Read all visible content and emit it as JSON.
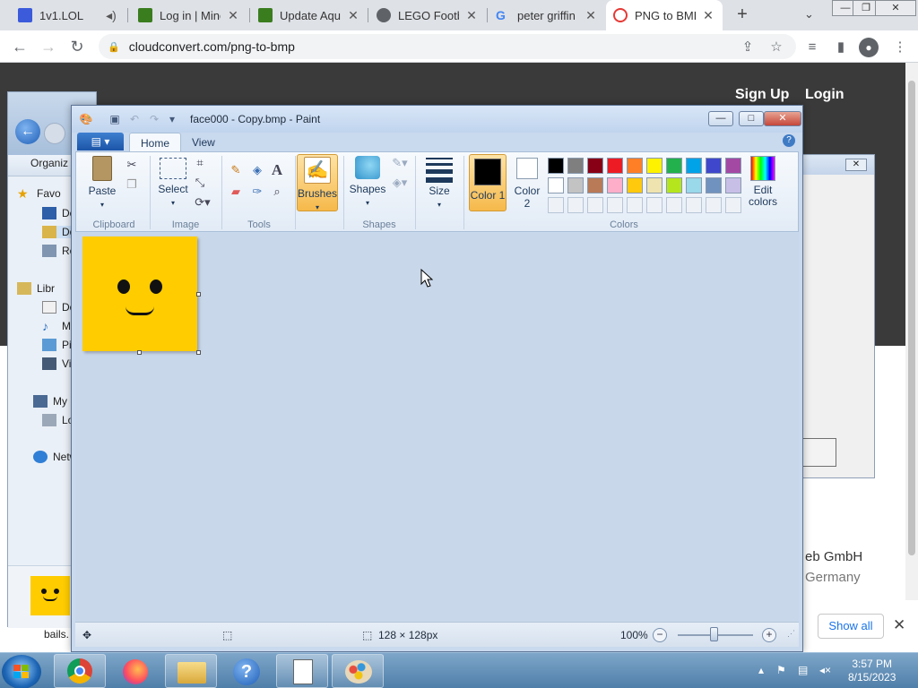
{
  "browser": {
    "tabs": [
      {
        "title": "1v1.LOL",
        "favicon_color": "#3b5bdb"
      },
      {
        "title": "Log in | Mine",
        "favicon_color": "#3a7d1e"
      },
      {
        "title": "Update Aqu",
        "favicon_color": "#3a7d1e"
      },
      {
        "title": "LEGO Footb",
        "favicon_color": "#5f6368"
      },
      {
        "title": "peter griffin",
        "favicon_color": "#4285f4"
      },
      {
        "title": "PNG to BMP",
        "favicon_color": "#e53935"
      }
    ],
    "new_tab": "+",
    "url": "cloudconvert.com/png-to-bmp"
  },
  "website": {
    "sign_up": "Sign Up",
    "login": "Login",
    "footer_company": "eb GmbH",
    "footer_country": "Germany",
    "show_all": "Show all"
  },
  "explorer": {
    "organize": "Organiz",
    "items": [
      "Favo",
      "De",
      "Do",
      "Re",
      "Libr",
      "Do",
      "M",
      "Pi",
      "Vi",
      "My",
      "Lo",
      "Netw"
    ],
    "file_partial": "bails."
  },
  "paint": {
    "title": "face000 - Copy.bmp - Paint",
    "tabs": {
      "home": "Home",
      "view": "View"
    },
    "groups": {
      "clipboard": "Clipboard",
      "image": "Image",
      "tools": "Tools",
      "shapes": "Shapes",
      "colors": "Colors"
    },
    "buttons": {
      "paste": "Paste",
      "select": "Select",
      "brushes": "Brushes",
      "shapes": "Shapes",
      "size": "Size",
      "color1": "Color 1",
      "color2": "Color 2",
      "edit_colors": "Edit colors"
    },
    "palette_row1": [
      "#000000",
      "#7f7f7f",
      "#880015",
      "#ed1c24",
      "#ff7f27",
      "#fff200",
      "#22b14c",
      "#00a2e8",
      "#3f48cc",
      "#a349a4"
    ],
    "palette_row2": [
      "#ffffff",
      "#c3c3c3",
      "#b97a57",
      "#ffaec9",
      "#ffc90e",
      "#efe4b0",
      "#b5e61d",
      "#99d9ea",
      "#7092be",
      "#c8bfe7"
    ],
    "color1_value": "#000000",
    "color2_value": "#ffffff",
    "canvas_color": "#ffcc00",
    "status": {
      "dimensions": "128 × 128px",
      "zoom": "100%"
    }
  },
  "taskbar": {
    "time": "3:57 PM",
    "date": "8/15/2023"
  }
}
